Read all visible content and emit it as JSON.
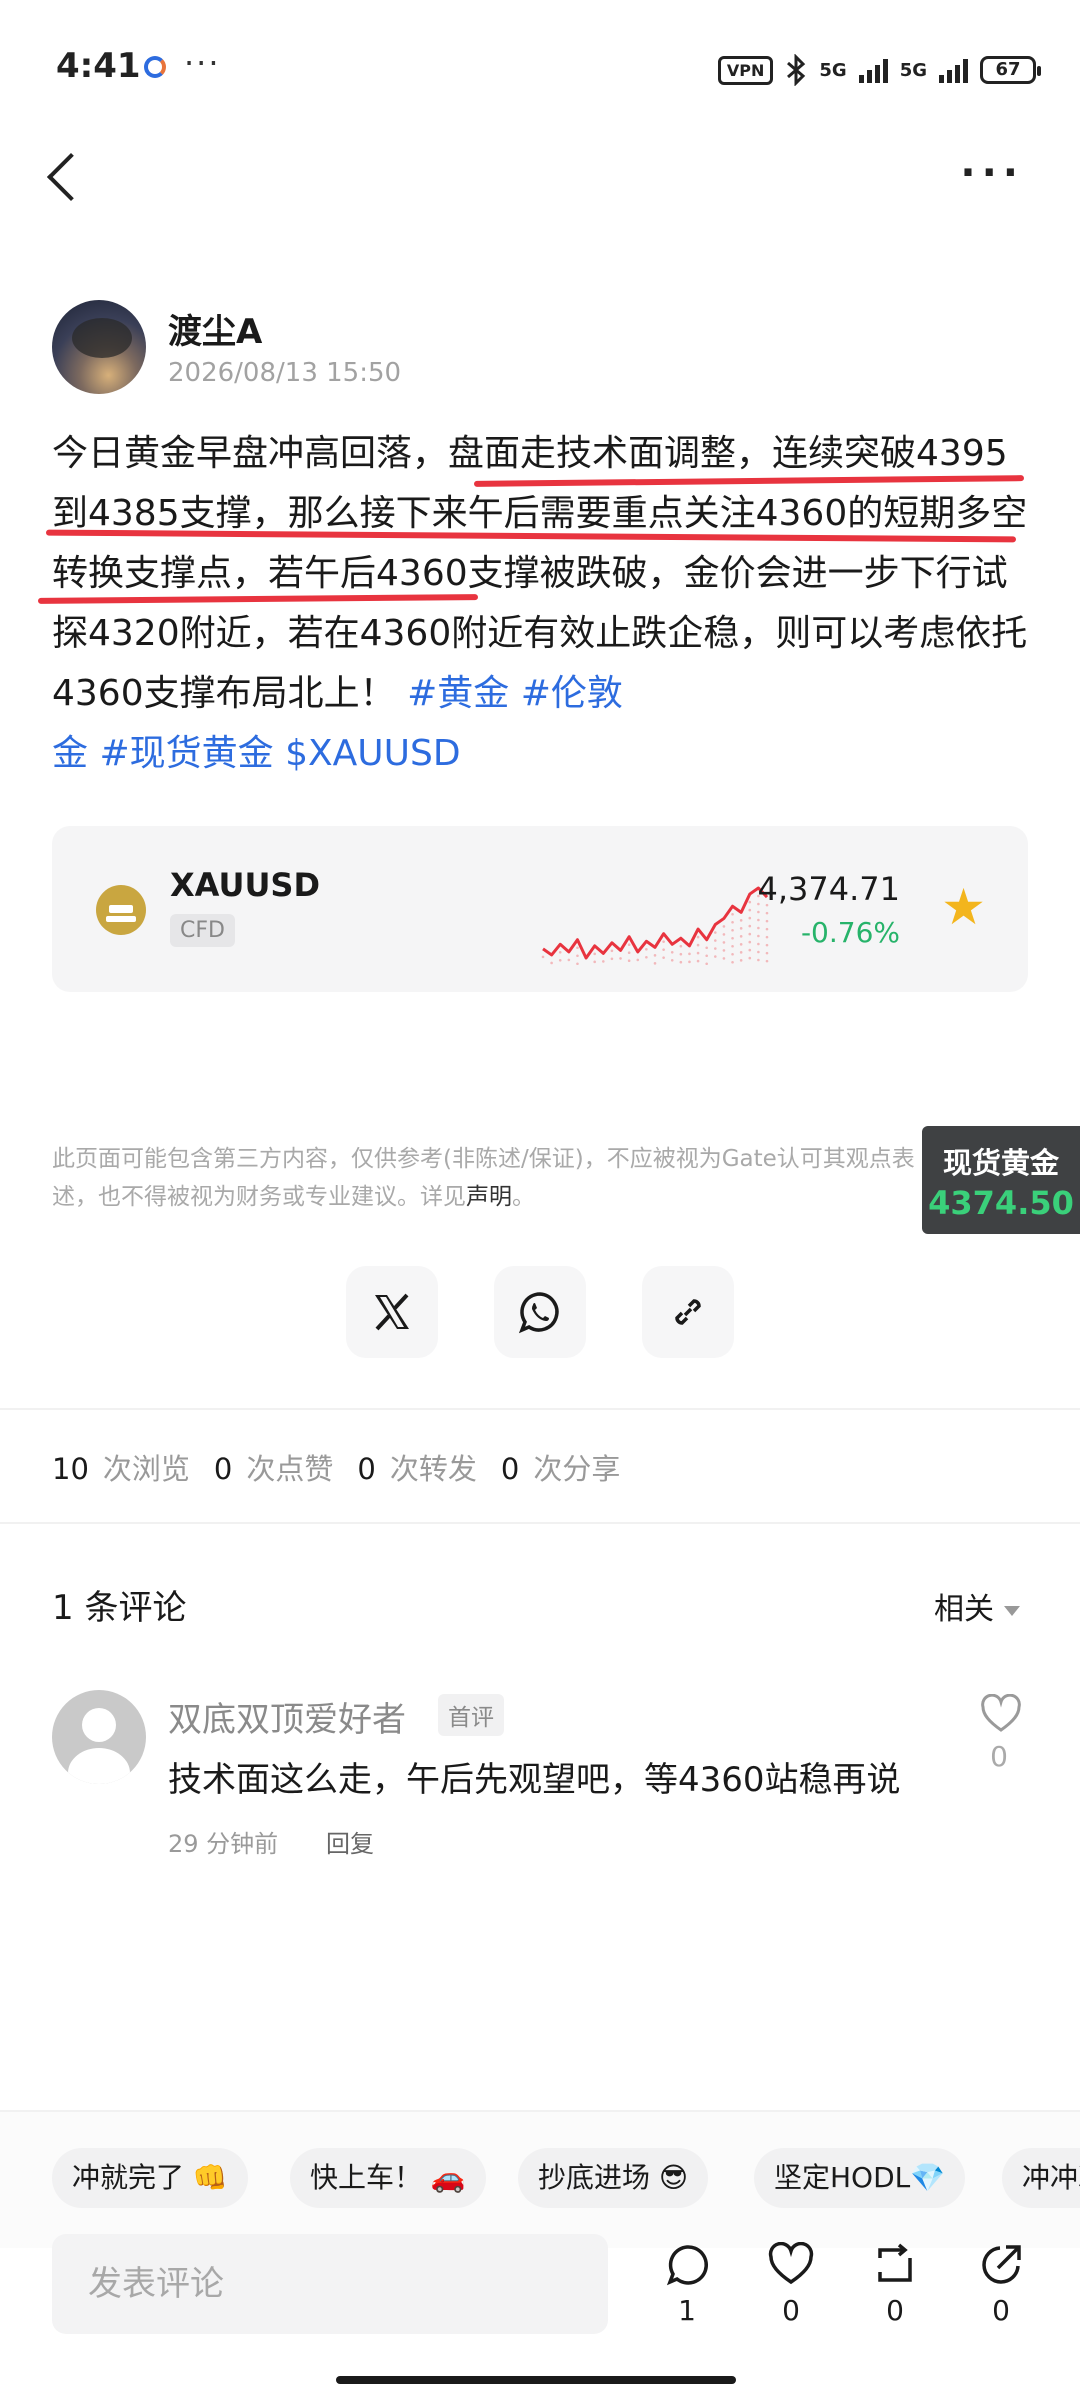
{
  "status_bar": {
    "time": "4:41",
    "more": "···",
    "vpn": "VPN",
    "sim1": "5G",
    "sim2": "5G",
    "battery": "67"
  },
  "post": {
    "author": "渡尘A",
    "datetime": "2026/08/13 15:50",
    "text_before": "今日黄金早盘冲高回落，",
    "text_highlight": "盘面走技术面调整，连续突破4395到4385支撑，那么接下来午后需要重点关注4360的短期多空转换支撑点，",
    "text_after": "若午后4360支撑被跌破，金价会进一步下行试探4320附近，若在4360附近有效止跌企稳，则可以考虑依托4360支撑布局北上！",
    "tags": [
      "#黄金",
      "#伦敦金",
      "#现货黄金",
      "$XAUUSD"
    ],
    "tags_display": {
      "t0": "#黄金",
      "t1": "#伦敦",
      "t1b": "金",
      "t2": "#现货黄金",
      "t3": "$XAUUSD"
    }
  },
  "ticker": {
    "symbol": "XAUUSD",
    "type": "CFD",
    "price": "4,374.71",
    "change": "-0.76%",
    "favorited": true,
    "sparkline": [
      42,
      38,
      45,
      40,
      48,
      36,
      44,
      39,
      46,
      41,
      50,
      40,
      47,
      43,
      52,
      45,
      49,
      44,
      55,
      48,
      58,
      62,
      70,
      66,
      78,
      82,
      76
    ]
  },
  "disclaimer": {
    "text": "此页面可能包含第三方内容，仅供参考(非陈述/保证)，不应被视为Gate认可其观点表述，也不得被视为财务或专业建议。详见",
    "link": "声明",
    "end": "。"
  },
  "floating_quote": {
    "name": "现货黄金",
    "price": "4374.50"
  },
  "share": {
    "items": [
      "x-share",
      "whatsapp-share",
      "copy-link"
    ]
  },
  "stats": {
    "views": "10",
    "views_label": "次浏览",
    "likes": "0",
    "likes_label": "次点赞",
    "reposts": "0",
    "reposts_label": "次转发",
    "shares": "0",
    "shares_label": "次分享"
  },
  "comments": {
    "title": "1 条评论",
    "sort": "相关",
    "items": [
      {
        "user": "双底双顶爱好者",
        "badge": "首评",
        "text": "技术面这么走，午后先观望吧，等4360站稳再说",
        "time": "29 分钟前",
        "reply": "回复",
        "likes": "0"
      }
    ]
  },
  "quick_replies": [
    "冲就完了 👊",
    "快上车！ 🚗",
    "抄底进场 😎",
    "坚定HODL💎",
    "冲冲冲"
  ],
  "bottom_bar": {
    "placeholder": "发表评论",
    "comment_count": "1",
    "like_count": "0",
    "repost_count": "0",
    "share_count": "0"
  },
  "colors": {
    "link_blue": "#2d6cdf",
    "underline_red": "#e8343f",
    "up_green": "#27b36a",
    "star_gold": "#f3b51d",
    "sparkline_red": "#e8343f"
  }
}
